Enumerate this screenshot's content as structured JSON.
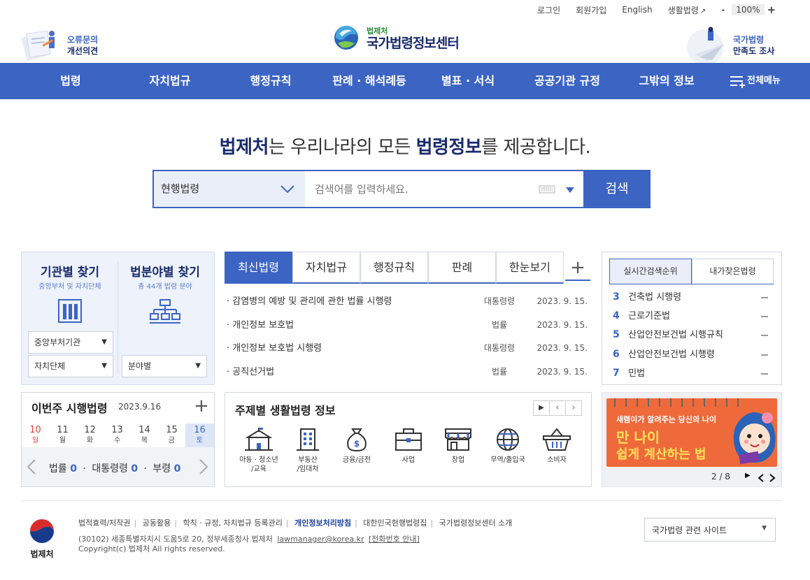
{
  "util": {
    "login": "로그인",
    "join": "회원가입",
    "english": "English",
    "life": "생활법령",
    "zoom_minus": "-",
    "zoom": "100%",
    "zoom_plus": "+"
  },
  "header": {
    "left_badge_line1": "오류문의",
    "left_badge_line2": "개선의견",
    "logo_sub": "법제처",
    "logo_title": "국가법령정보센터",
    "right_badge_line1": "국가법령",
    "right_badge_line2": "만족도 조사"
  },
  "nav": {
    "items": [
      "법령",
      "자치법규",
      "행정규칙",
      "판례 · 해석례등",
      "별표 · 서식",
      "공공기관 규정",
      "그밖의 정보"
    ],
    "all_menu": "전체메뉴"
  },
  "headline": {
    "p1": "법제처",
    "p2": "는 우리나라의 모든 ",
    "p3": "법령정보",
    "p4": "를 제공합니다."
  },
  "search": {
    "scope": "현행법령",
    "placeholder": "검색어를 입력하세요.",
    "button": "검색"
  },
  "finder": {
    "org_title": "기관별 찾기",
    "org_sub": "중앙부처 및 자치단체",
    "field_title": "법분야별 찾기",
    "field_sub": "총 44개 법령 분야",
    "sel_central": "중앙부처기관",
    "sel_local": "자치단체",
    "sel_field": "분야별"
  },
  "law_tabs": {
    "tabs": [
      "최신법령",
      "자치법규",
      "행정규칙",
      "판례",
      "한눈보기"
    ],
    "plus": "+"
  },
  "laws": [
    {
      "title": "· 감염병의 예방 및 관리에 관한 법률 시행령",
      "kind": "대통령령",
      "date": "2023. 9. 15."
    },
    {
      "title": "· 개인정보 보호법",
      "kind": "법률",
      "date": "2023. 9. 15."
    },
    {
      "title": "· 개인정보 보호법 시행령",
      "kind": "대통령령",
      "date": "2023. 9. 15."
    },
    {
      "title": "· 공직선거법",
      "kind": "법률",
      "date": "2023. 9. 15."
    }
  ],
  "rank": {
    "tab1": "실시간검색순위",
    "tab2": "내가찾은법령",
    "items": [
      {
        "n": "3",
        "name": "건축법 시행령"
      },
      {
        "n": "4",
        "name": "근로기준법"
      },
      {
        "n": "5",
        "name": "산업안전보건법 시행규칙"
      },
      {
        "n": "6",
        "name": "산업안전보건법 시행령"
      },
      {
        "n": "7",
        "name": "민법"
      }
    ]
  },
  "week": {
    "title": "이번주 시행법령",
    "date": "2023.9.16",
    "plus": "+",
    "days": [
      {
        "num": "10",
        "wd": "일"
      },
      {
        "num": "11",
        "wd": "월"
      },
      {
        "num": "12",
        "wd": "화"
      },
      {
        "num": "13",
        "wd": "수"
      },
      {
        "num": "14",
        "wd": "목"
      },
      {
        "num": "15",
        "wd": "금"
      },
      {
        "num": "16",
        "wd": "토"
      }
    ],
    "law_label": "법률",
    "law_count": "0",
    "decree_label": "대통령령",
    "decree_count": "0",
    "ordinance_label": "부령",
    "ordinance_count": "0"
  },
  "theme": {
    "title": "주제별 생활법령 정보",
    "cats": [
      "아동 · 청소년\n/교육",
      "부동산\n/임대차",
      "금융/금전",
      "사업",
      "창업",
      "무역/출입국",
      "소비자"
    ]
  },
  "banner": {
    "line1": "새렴이가 알려주는 당신의 나이",
    "line2": "만 나이",
    "line3": "쉽게 계산하는 법",
    "page": "2 / 8"
  },
  "footer": {
    "links": [
      "법적효력/저작권",
      "공동활용",
      "학칙 · 규정, 자치법규 등록관리",
      "개인정보처리방침",
      "대한민국현행법령집",
      "국가법령정보센터 소개"
    ],
    "addr": "(30102) 세종특별자치시 도움5로 20, 정부세종청사 법제처",
    "email": "lawmanager@korea.kr",
    "phone": "[전화번호 안내]",
    "copy": "Copyright(c) 법제처 All rights reserved.",
    "related": "국가법령 관련 사이트",
    "emblem": "법제처"
  },
  "colors": {
    "primary": "#3c64c3",
    "navy": "#1a2b6d",
    "accent_green": "#2e8b3a"
  }
}
